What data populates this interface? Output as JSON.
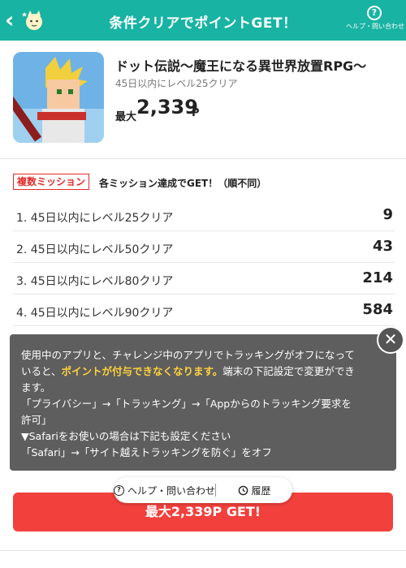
{
  "header": {
    "title": "条件クリアでポイントGET！",
    "back_icon": "back-chevron-icon",
    "mascot_icon": "cat-mascot-icon",
    "help_label": "ヘルプ・問い合わせ",
    "help_icon": "question-circle-icon"
  },
  "colors": {
    "header_bg": "#18b3a3",
    "accent_red": "#f2403d",
    "badge_red": "#e02a2a",
    "highlight_yellow": "#ffd23c"
  },
  "app": {
    "name": "ドット伝説〜魔王になる異世界放置RPG〜",
    "condition": "45日以内にレベル25クリア",
    "max_label": "最大",
    "max_points": "2,339",
    "unit": "P"
  },
  "missions": {
    "badge": "複数ミッション",
    "description": "各ミッション達成でGET！（順不同）",
    "items": [
      {
        "label": "1. 45日以内にレベル25クリア",
        "points": "9"
      },
      {
        "label": "2. 45日以内にレベル50クリア",
        "points": "43"
      },
      {
        "label": "3. 45日以内にレベル80クリア",
        "points": "214"
      },
      {
        "label": "4. 45日以内にレベル90クリア",
        "points": "584"
      }
    ]
  },
  "overlay": {
    "line1": "使用中のアプリと、チャレンジ中のアプリでトラッキングがオフになって",
    "line2_pre": "いると、",
    "line2_highlight": "ポイントが付与できなくなります。",
    "line2_post": "端末の下記設定で変更ができ",
    "line3": "ます。",
    "line4": "「プライバシー」→「トラッキング」→「Appからのトラッキング要求を",
    "line5": "許可」",
    "line6": "▼Safariをお使いの場合は下記も設定ください",
    "line7": "「Safari」→「サイト越えトラッキングを防ぐ」をオフ",
    "close_icon": "close-x-icon"
  },
  "pill": {
    "help_label": "ヘルプ・問い合わせ",
    "history_label": "履歴",
    "help_icon": "question-circle-icon",
    "history_icon": "clock-history-icon"
  },
  "get_button": {
    "label": "最大2,339P GET!"
  }
}
